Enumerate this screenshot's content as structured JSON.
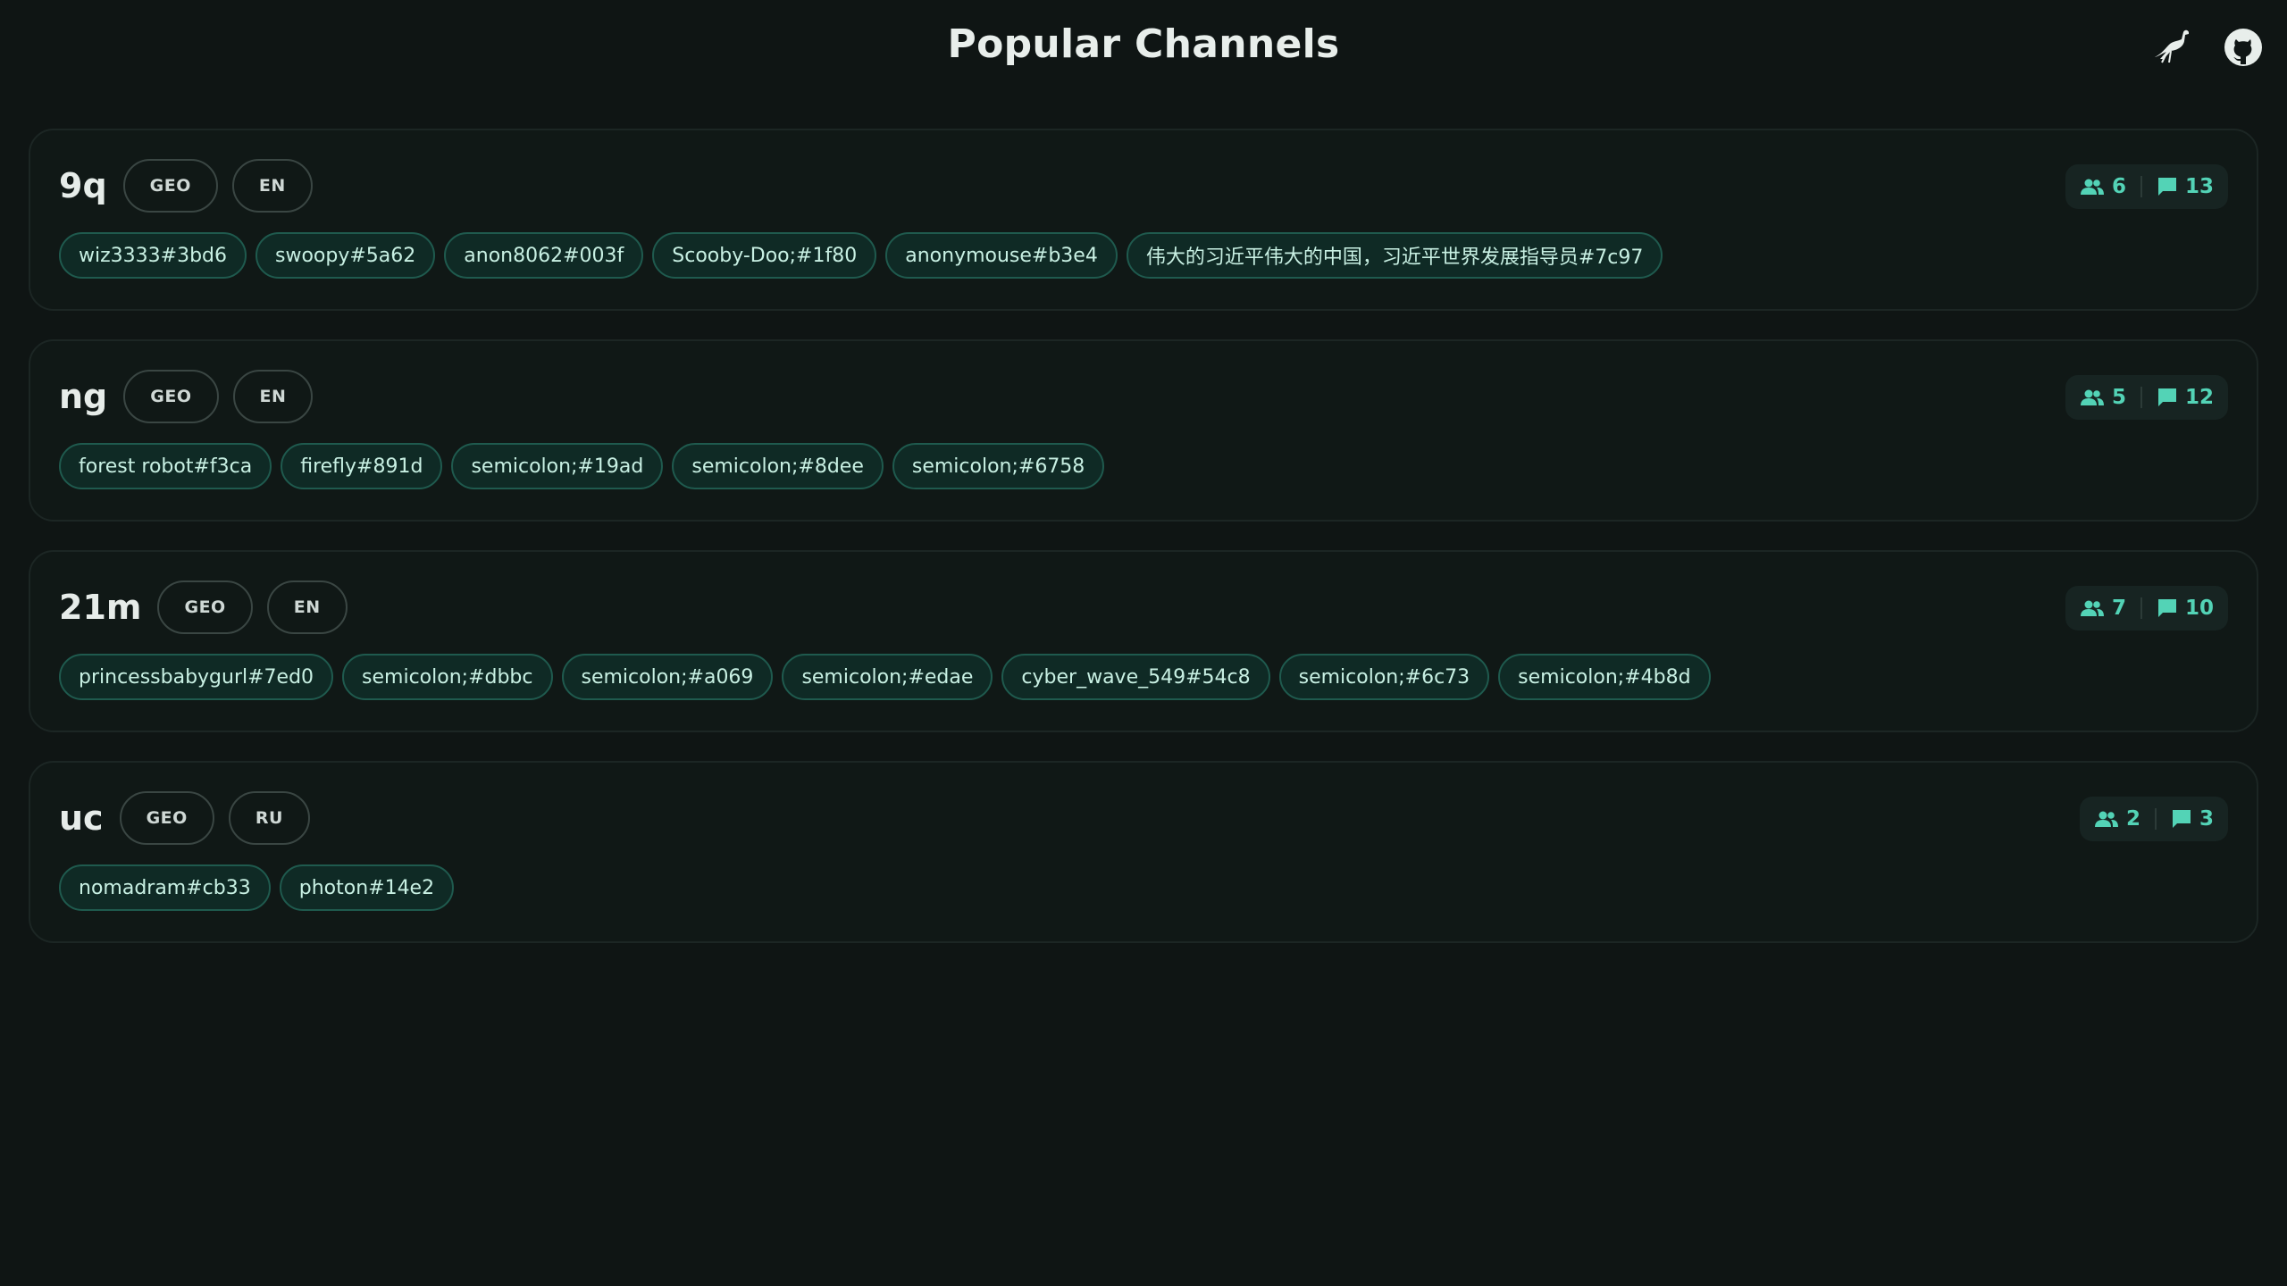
{
  "header": {
    "title": "Popular Channels",
    "icons": [
      "bird-icon",
      "github-icon"
    ]
  },
  "colors": {
    "background": "#0f1514",
    "accent": "#53d3b6",
    "chip_bg": "#0f2a25",
    "chip_border": "#1f5a4e"
  },
  "channels": [
    {
      "geohash": "9q",
      "tags": [
        "GEO",
        "EN"
      ],
      "user_count": "6",
      "message_count": "13",
      "users": [
        "wiz3333#3bd6",
        "swoopy#5a62",
        "anon8062#003f",
        "Scooby-Doo;#1f80",
        "anonymouse#b3e4",
        "伟大的习近平伟大的中国，习近平世界发展指导员#7c97"
      ]
    },
    {
      "geohash": "ng",
      "tags": [
        "GEO",
        "EN"
      ],
      "user_count": "5",
      "message_count": "12",
      "users": [
        "forest robot#f3ca",
        "firefly#891d",
        "semicolon;#19ad",
        "semicolon;#8dee",
        "semicolon;#6758"
      ]
    },
    {
      "geohash": "21m",
      "tags": [
        "GEO",
        "EN"
      ],
      "user_count": "7",
      "message_count": "10",
      "users": [
        "princessbabygurl#7ed0",
        "semicolon;#dbbc",
        "semicolon;#a069",
        "semicolon;#edae",
        "cyber_wave_549#54c8",
        "semicolon;#6c73",
        "semicolon;#4b8d"
      ]
    },
    {
      "geohash": "uc",
      "tags": [
        "GEO",
        "RU"
      ],
      "user_count": "2",
      "message_count": "3",
      "users": [
        "nomadram#cb33",
        "photon#14e2"
      ]
    }
  ]
}
